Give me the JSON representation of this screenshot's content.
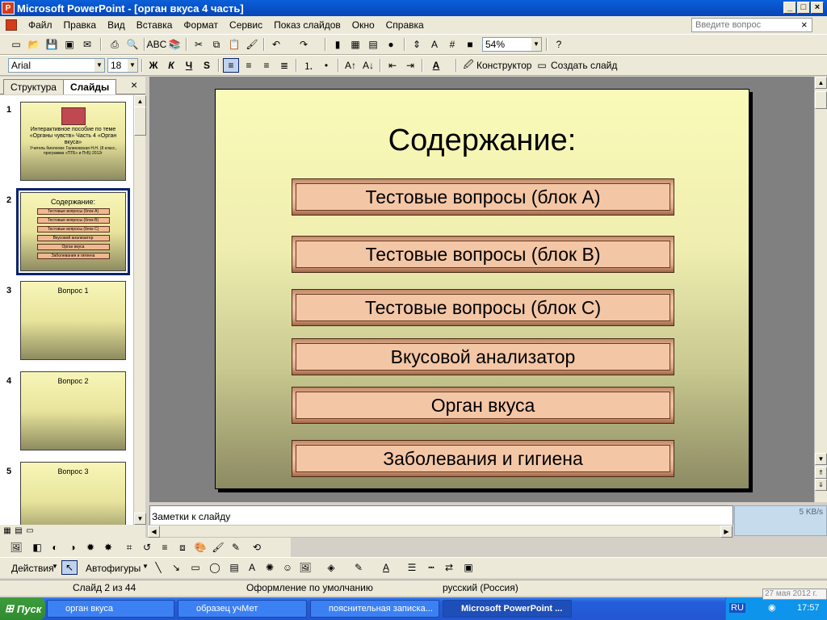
{
  "window": {
    "title": "Microsoft PowerPoint - [орган вкуса 4 часть]",
    "app_icon": "powerpoint-icon"
  },
  "menu": [
    "Файл",
    "Правка",
    "Вид",
    "Вставка",
    "Формат",
    "Сервис",
    "Показ слайдов",
    "Окно",
    "Справка"
  ],
  "help": {
    "placeholder": "Введите вопрос"
  },
  "standard_toolbar": {
    "zoom": "54%"
  },
  "format_toolbar": {
    "font": "Arial",
    "size": "18",
    "bold": "Ж",
    "italic": "К",
    "underline": "Ч",
    "shadow": "S",
    "designer": "Конструктор",
    "new_slide": "Создать слайд"
  },
  "left_pane": {
    "tab_outline": "Структура",
    "tab_slides": "Слайды"
  },
  "thumbnails": [
    {
      "num": "1",
      "title": "Интерактивное пособие по теме «Органы чувств» Часть 4 «Орган вкуса»",
      "sub": "Учитель биологии: Галиновская Н.Н. (8 класс, программа «ПТБ» и ПтБ) 2012г"
    },
    {
      "num": "2",
      "title": "Содержание:",
      "items": [
        "Тестовые вопросы (блок А)",
        "Тестовые вопросы (блок В)",
        "Тестовые вопросы (блок С)",
        "Вкусовой анализатор",
        "Орган вкуса",
        "Заболевания и гигиена"
      ]
    },
    {
      "num": "3",
      "title": "Вопрос 1"
    },
    {
      "num": "4",
      "title": "Вопрос 2"
    },
    {
      "num": "5",
      "title": "Вопрос 3"
    }
  ],
  "slide": {
    "title": "Содержание:",
    "buttons": [
      "Тестовые вопросы (блок А)",
      "Тестовые вопросы (блок В)",
      "Тестовые вопросы (блок С)",
      "Вкусовой анализатор",
      "Орган вкуса",
      "Заболевания и гигиена"
    ]
  },
  "notes": {
    "placeholder": "Заметки к слайду"
  },
  "net_widget": {
    "speed": "5 KB/s"
  },
  "draw_toolbar": {
    "actions": "Действия",
    "autoshapes": "Автофигуры"
  },
  "status": {
    "slide": "Слайд 2 из 44",
    "design": "Оформление по умолчанию",
    "language": "русский (Россия)"
  },
  "taskbar": {
    "start": "Пуск",
    "tasks": [
      "орган вкуса",
      "образец учМет",
      "пояснительная записка...",
      "Microsoft PowerPoint ..."
    ],
    "lang": "RU",
    "time": "17:57",
    "date_tip": "27 мая 2012 г."
  }
}
